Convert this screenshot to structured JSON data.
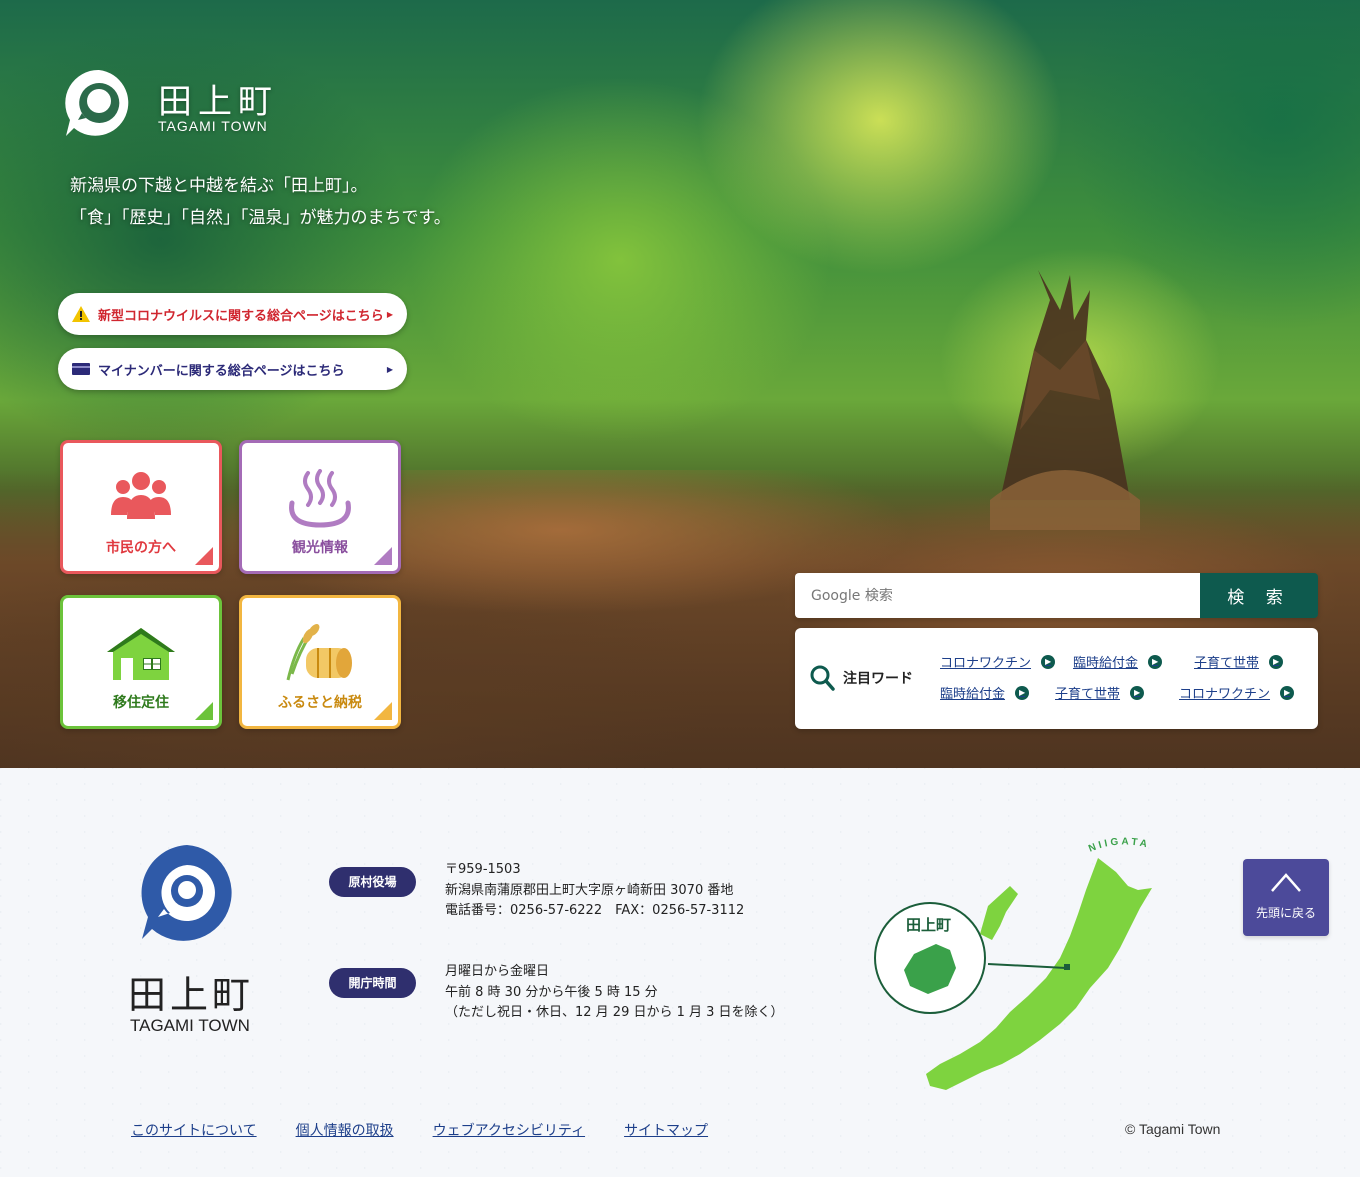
{
  "header": {
    "title": "田上町",
    "title_en": "TAGAMI TOWN",
    "tagline_1": "新潟県の下越と中越を結ぶ「田上町」。",
    "tagline_2": "「食」「歴史」「自然」「温泉」が魅力のまちです。"
  },
  "notices": [
    {
      "label": "新型コロナウイルスに関する総合ページはこちら",
      "icon": "warning-icon",
      "color": "#d0262f"
    },
    {
      "label": "マイナンバーに関する総合ページはこちら",
      "icon": "card-icon",
      "color": "#2c2a78"
    }
  ],
  "tiles": [
    {
      "label": "市民の方へ",
      "icon": "people-icon",
      "color": "#e9585c"
    },
    {
      "label": "観光情報",
      "icon": "hot-spring-icon",
      "color": "#a46bb6"
    },
    {
      "label": "移住定住",
      "icon": "house-icon",
      "color": "#6cc33b"
    },
    {
      "label": "ふるさと納税",
      "icon": "rice-bale-icon",
      "color": "#f2b640"
    }
  ],
  "search": {
    "placeholder": "Google 検索",
    "button": "検 索"
  },
  "keywords": {
    "heading": "注目ワード",
    "items": [
      "コロナワクチン",
      "臨時給付金",
      "子育て世帯",
      "臨時給付金",
      "子育て世帯",
      "コロナワクチン"
    ]
  },
  "footer": {
    "title": "田上町",
    "title_en": "TAGAMI TOWN",
    "office_badge": "原村役場",
    "postal": "〒959-1503",
    "address": "新潟県南蒲原郡田上町大字原ヶ崎新田 3070 番地",
    "phone": "電話番号：0256-57-6222　FAX：0256-57-3112",
    "hours_badge": "開庁時間",
    "hours_1": "月曜日から金曜日",
    "hours_2": "午前 8 時 30 分から午後 5 時 15 分",
    "hours_3": "（ただし祝日・休日、12 月 29 日から 1 月 3 日を除く）",
    "map_prefecture": "NIIGATA",
    "map_town": "田上町",
    "to_top": "先頭に戻る",
    "links": [
      "このサイトについて",
      "個人情報の取扱",
      "ウェブアクセシビリティ",
      "サイトマップ"
    ],
    "copyright": "© Tagami Town"
  },
  "colors": {
    "brand": "#2f5aa8",
    "search_button": "#0e5a4e",
    "badge": "#2f2f6e",
    "to_top": "#4c4a9a",
    "map_green": "#7ed33f"
  }
}
